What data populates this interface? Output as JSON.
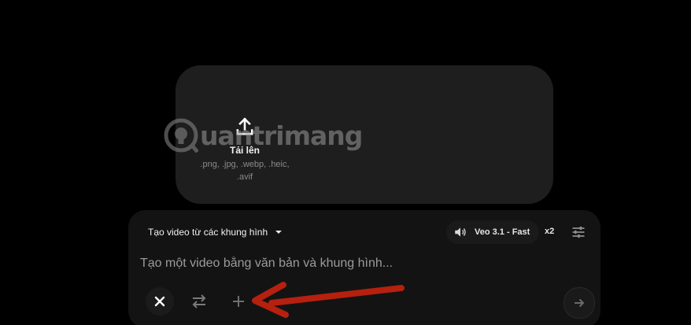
{
  "upload": {
    "label": "Tải lên",
    "formats": ".png, .jpg, .webp, .heic, .avif"
  },
  "watermark": {
    "text": "uantrimang"
  },
  "composer": {
    "mode_label": "Tạo video từ các khung hình",
    "model_label": "Veo 3.1 - Fast",
    "count_label": "x2",
    "prompt_placeholder": "Tạo một video bằng văn bản và khung hình..."
  },
  "icons": {
    "upload": "upload-icon",
    "speaker": "speaker-icon",
    "settings": "settings-sliders-icon",
    "close": "close-icon",
    "swap": "swap-arrows-icon",
    "add": "plus-icon",
    "send": "arrow-right-icon",
    "annotation": "red-arrow-icon"
  },
  "colors": {
    "background": "#000000",
    "card": "#1e1e1e",
    "panel": "#131313",
    "annotation_arrow": "#b5200f"
  }
}
